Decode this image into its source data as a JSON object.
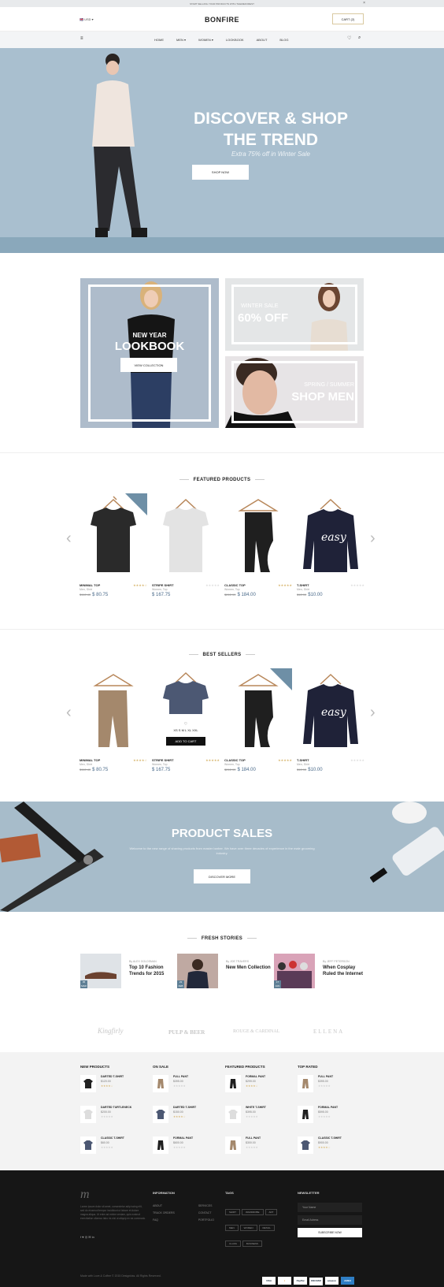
{
  "topbar": {
    "text": "START SELLING YOUR PRODUCTS WITH THEMEFOREST",
    "close": "×"
  },
  "header": {
    "lang": "🇬🇧 USD ▾",
    "logo": "BONFIRE",
    "cart": "CART (2)"
  },
  "nav": {
    "items": [
      "HOME",
      "MEN ▾",
      "WOMEN ▾",
      "LOOKBOOK",
      "ABOUT",
      "BLOG"
    ]
  },
  "hero": {
    "title1": "DISCOVER & SHOP",
    "title2": "THE TREND",
    "subtitle": "Extra 75% off in Winter Sale",
    "button": "SHOP NOW"
  },
  "banners": {
    "lookbook": {
      "small": "NEW YEAR",
      "big": "LOOKBOOK",
      "button": "VIEW COLLECTION"
    },
    "winter": {
      "small": "WINTER SALE",
      "big": "60% OFF"
    },
    "men": {
      "small": "SPRING / SUMMER",
      "big": "SHOP MEN"
    }
  },
  "featured": {
    "title": "FEATURED PRODUCTS",
    "products": [
      {
        "name": "MINIMAL TOP",
        "cat": "Men, Shirt",
        "old": "$112.40",
        "price": "$ 80.75",
        "badge": "SALE"
      },
      {
        "name": "STRIPE SHIRT",
        "cat": "Women, Top",
        "old": "",
        "price": "$ 167.75"
      },
      {
        "name": "CLASSIC TOP",
        "cat": "Women, Top",
        "old": "$212.90",
        "price": "$ 184.00"
      },
      {
        "name": "T-SHIRT",
        "cat": "Men, Shirt",
        "old": "$12.90",
        "price": "$10.00"
      }
    ]
  },
  "best": {
    "title": "BEST SELLERS",
    "sizes": "XS S M L XL XXL",
    "addtocart": "ADD TO CART",
    "products": [
      {
        "name": "MINIMAL TOP",
        "cat": "Men, Shirt",
        "old": "$112.40",
        "price": "$ 80.75"
      },
      {
        "name": "STRIPE SHIRT",
        "cat": "Women, Top",
        "old": "",
        "price": "$ 167.75"
      },
      {
        "name": "CLASSIC TOP",
        "cat": "Women, Top",
        "old": "$212.90",
        "price": "$ 184.00",
        "badge": "SALE"
      },
      {
        "name": "T-SHIRT",
        "cat": "Men, Shirt",
        "old": "$12.90",
        "price": "$10.00"
      }
    ]
  },
  "sales": {
    "title": "PRODUCT SALES",
    "text": "Welcome to the new range of shaving products from master barber. We have over three decades of experience in the male grooming industry.",
    "button": "DISCOVER MORE"
  },
  "stories": {
    "title": "FRESH STORIES",
    "items": [
      {
        "by": "By ALEX GOLDSMAN",
        "title": "Top 10 Fashion Trends for 2015",
        "day": "05",
        "mon": "MAR"
      },
      {
        "by": "By JOE TRAVERS",
        "title": "New Men Collection",
        "day": "23",
        "mon": "FEB"
      },
      {
        "by": "By JEFF PETERSON",
        "title": "When Cosplay Ruled the Internet",
        "day": "17",
        "mon": "JAN"
      }
    ]
  },
  "brands": [
    "Kingfirly",
    "PULP & BEER",
    "ROUGE & CARDINAL",
    "ELLENA"
  ],
  "lists": [
    {
      "title": "NEW PRODUCTS",
      "items": [
        {
          "n": "DARTED T-SHIRT",
          "p": "$120.00"
        },
        {
          "n": "DARTED TURTLENECK",
          "p": "$200.00"
        },
        {
          "n": "CLASSIC T-SHIRT",
          "p": "$60.00"
        }
      ]
    },
    {
      "title": "ON SALE",
      "items": [
        {
          "n": "FULL PANT",
          "p": "$395.00"
        },
        {
          "n": "DARTED T-SHIRT",
          "p": "$150.00"
        },
        {
          "n": "FORMAL PANT",
          "p": "$600.00"
        }
      ]
    },
    {
      "title": "FEATURED PRODUCTS",
      "items": [
        {
          "n": "FORMAL PANT",
          "p": "$299.00"
        },
        {
          "n": "WHITE T-SHIRT",
          "p": "$395.00"
        },
        {
          "n": "FULL PANT",
          "p": "$300.00"
        }
      ]
    },
    {
      "title": "TOP RATED",
      "items": [
        {
          "n": "FULL PANT",
          "p": "$395.00"
        },
        {
          "n": "FORMAL PANT",
          "p": "$595.00"
        },
        {
          "n": "CLASSIC T-SHIRT",
          "p": "$900.00"
        }
      ]
    }
  ],
  "footer": {
    "about": "Lorem ipsum dolor sit amet, consectetur adip iscing elit, sed do eiusmod tempor incididunt ut labore et dolore magna aliqua. Ut enim ad minim veniam, quis nostrud exercitation ullamco labo ris nisi ut aliquip ex ea commodo.",
    "social": "f  ♥  ◎  ✉  in",
    "info_title": "INFORMATION",
    "info": [
      "ABOUT",
      "TRACK ORDERS",
      "FAQ"
    ],
    "info2": [
      "SERVICES",
      "CONTACT",
      "PORTFOLIO"
    ],
    "tags_title": "TAGS",
    "tags": [
      "SHIRT",
      "WARDROBE",
      "ART",
      "MEN",
      "WOMEN",
      "RETAIL",
      "CLASS",
      "BUSINESS"
    ],
    "news_title": "NEWSLETTER",
    "name_ph": "Your Name",
    "email_ph": "Email Adress",
    "subscribe": "SUBSCRIBE NOW",
    "copyright": "Made with Love & Coffee © 2015 Designkiss. All Rights Reserved.",
    "payments": [
      "VISA",
      "◐",
      "PayPal",
      "DISCOVER",
      "amazon",
      "AMEX"
    ]
  }
}
